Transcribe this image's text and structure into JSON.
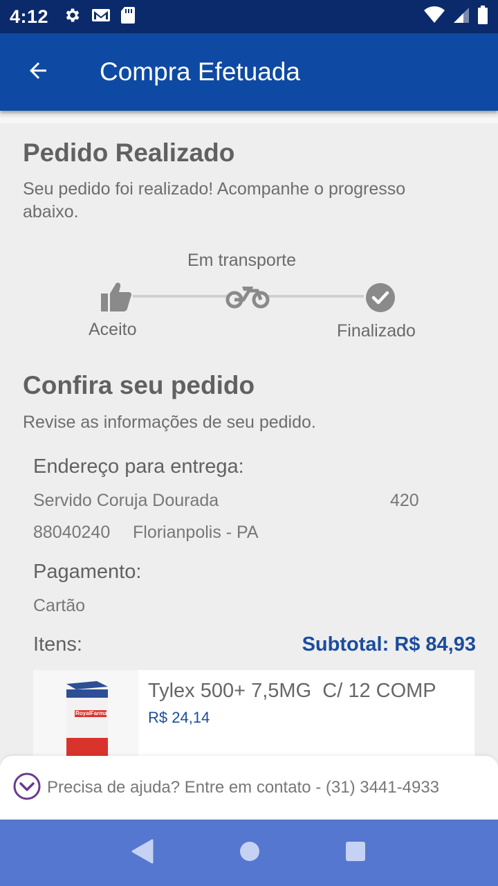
{
  "status_bar": {
    "time": "4:12",
    "icons": [
      "gear-icon",
      "gmail-icon",
      "sd-card-icon"
    ],
    "right_icons": [
      "wifi-icon",
      "signal-icon",
      "battery-icon"
    ]
  },
  "app_bar": {
    "title": "Compra Efetuada",
    "back_icon": "arrow-left-icon"
  },
  "order": {
    "heading": "Pedido Realizado",
    "subtitle": "Seu pedido foi realizado! Acompanhe o progresso abaixo."
  },
  "progress": {
    "steps": [
      {
        "label": "Aceito",
        "icon": "thumbs-up-icon"
      },
      {
        "label": "Em transporte",
        "icon": "motorcycle-icon"
      },
      {
        "label": "Finalizado",
        "icon": "check-circle-icon"
      }
    ]
  },
  "review": {
    "heading": "Confira seu pedido",
    "subtitle": "Revise as informações de seu pedido."
  },
  "delivery": {
    "label": "Endereço para entrega:",
    "street": "Servido Coruja Dourada",
    "number": "420",
    "zip": "88040240",
    "city": "Florianpolis - PA"
  },
  "payment": {
    "label": "Pagamento:",
    "method": "Cartão"
  },
  "items": {
    "label": "Itens:",
    "subtotal": "Subtotal: R$ 84,93",
    "list": [
      {
        "name": "Tylex 500+ 7,5MG  C/ 12 COMP",
        "price": "R$ 24,14",
        "brand": "RoyalFarma"
      }
    ]
  },
  "help": {
    "text": "Precisa de ajuda? Entre em contato - (31) 3441-4933",
    "icon": "chevron-down-circle-icon"
  },
  "colors": {
    "status_bar": "#0b2a6b",
    "app_bar": "#0e4aa3",
    "accent": "#1a4d9c",
    "nav_bar": "#5577cf"
  }
}
